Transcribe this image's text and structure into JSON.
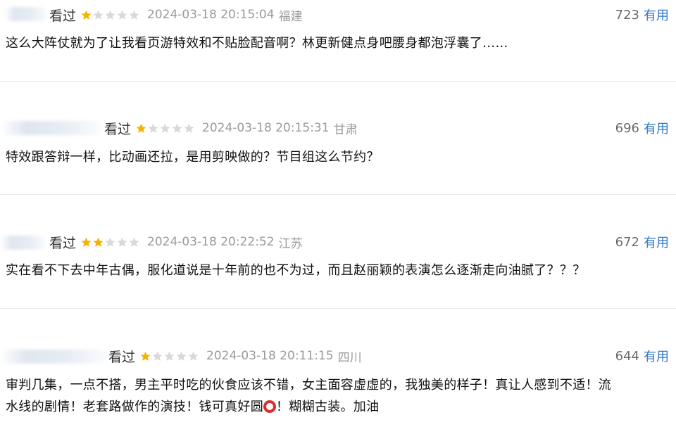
{
  "reviews": [
    {
      "status": "看过",
      "stars": 1,
      "date": "2024-03-18 20:15:04",
      "location": "福建",
      "count": "723",
      "useful": "有用",
      "text": "这么大阵仗就为了让我看页游特效和不贴脸配音啊？林更新健点身吧腰身都泡浮囊了……"
    },
    {
      "status": "看过",
      "stars": 1,
      "date": "2024-03-18 20:15:31",
      "location": "甘肃",
      "count": "696",
      "useful": "有用",
      "text": "特效跟答辩一样，比动画还拉，是用剪映做的？节目组这么节约？"
    },
    {
      "status": "看过",
      "stars": 2,
      "date": "2024-03-18 20:22:52",
      "location": "江苏",
      "count": "672",
      "useful": "有用",
      "text": "实在看不下去中年古偶，服化道说是十年前的也不为过，而且赵丽颖的表演怎么逐渐走向油腻了？？？"
    },
    {
      "status": "看过",
      "stars": 1,
      "date": "2024-03-18 20:11:15",
      "location": "四川",
      "count": "644",
      "useful": "有用",
      "text_line1": "审判几集，一点不搭，男主平时吃的伙食应该不错，女主面容虚虚的，我独美的样子！真让人感到不适！流",
      "text_line2_a": "水线的剧情！老套路做作的演技！钱可真好圆",
      "text_line2_b": "！糊糊古装。加油"
    }
  ],
  "colors": {
    "star_on": "#f5b400",
    "star_off": "#d9d9d9",
    "useful": "#2f77c6",
    "meta": "#9a9a9a"
  }
}
